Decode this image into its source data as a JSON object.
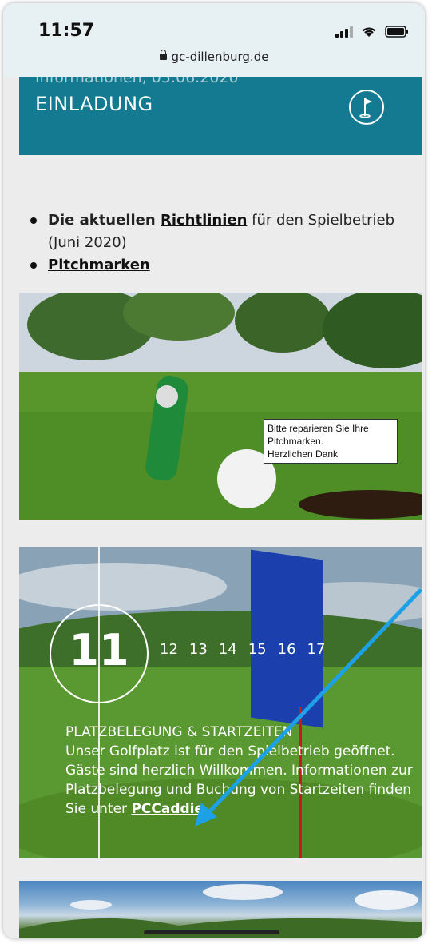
{
  "status": {
    "time": "11:57",
    "url": "gc-dillenburg.de"
  },
  "banner": {
    "subtitle": "Informationen, 05.06.2020",
    "title": "EINLADUNG",
    "icon": "flag-icon"
  },
  "list": {
    "item1_prefix": "Die aktuellen ",
    "item1_link": "Richtlinien",
    "item1_suffix": " für den Spielbetrieb (Juni 2020)",
    "item2_link": "Pitchmarken"
  },
  "photo1": {
    "caption_line1": "Bitte reparieren Sie Ihre",
    "caption_line2": "Pitchmarken.",
    "caption_line3": "Herzlichen Dank"
  },
  "photo2": {
    "hole_current": "11",
    "holes_next": [
      "12",
      "13",
      "14",
      "15",
      "16",
      "17"
    ],
    "heading": "PLATZBELEGUNG & STARTZEITEN",
    "body": "Unser Golfplatz ist für den Spielbetrieb geöffnet. Gäste sind herzlich Willkommen. Informationen zur Platzbelegung und Buchung von Startzeiten finden Sie unter ",
    "link": "PCCaddie",
    "end": "."
  },
  "colors": {
    "banner": "#137a92",
    "arrow": "#1da1e6",
    "flag": "#1c3fae"
  }
}
